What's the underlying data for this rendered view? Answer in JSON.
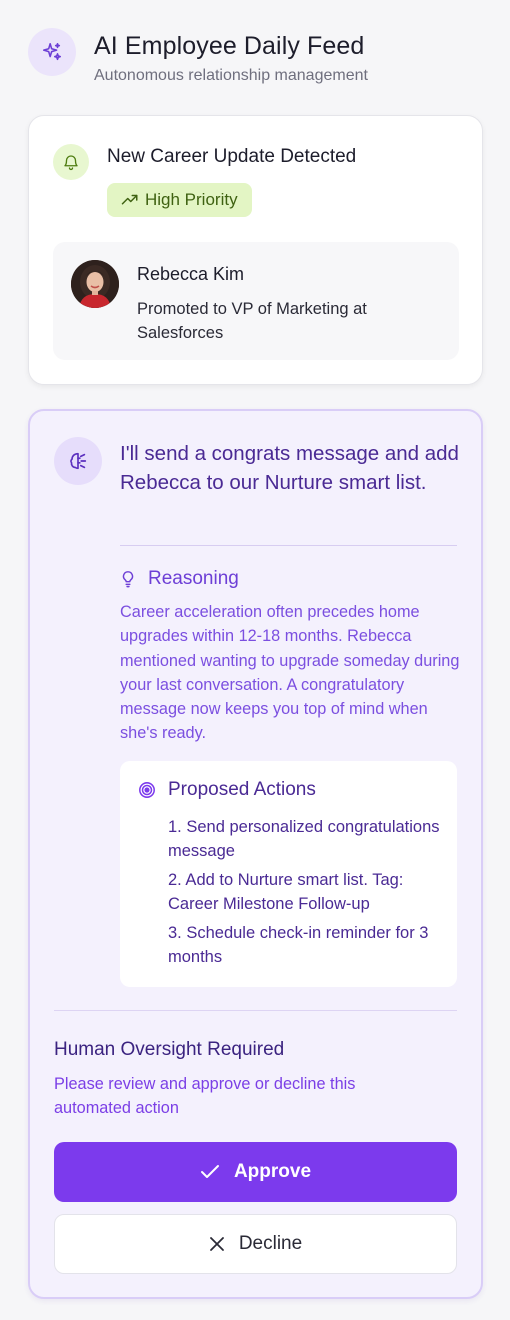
{
  "header": {
    "icon": "sparkles-icon",
    "title": "AI Employee Daily Feed",
    "subtitle": "Autonomous relationship management"
  },
  "alert_card": {
    "icon": "bell-icon",
    "title": "New Career Update Detected",
    "priority_icon": "trending-up-icon",
    "priority_label": "High Priority",
    "contact": {
      "name": "Rebecca Kim",
      "update": "Promoted to VP of Marketing at Salesforces"
    }
  },
  "ai_card": {
    "icon": "brain-icon",
    "message": "I'll send a congrats message and add Rebecca to our Nurture smart list.",
    "reasoning": {
      "icon": "lightbulb-icon",
      "title": "Reasoning",
      "text": "Career acceleration often precedes home upgrades within 12-18 months. Rebecca mentioned wanting to upgrade someday during your last conversation. A congratulatory message now keeps you top of mind when she's ready."
    },
    "proposed_actions": {
      "icon": "target-icon",
      "title": "Proposed Actions",
      "items": [
        "1. Send personalized congratulations message",
        "2. Add to Nurture smart list. Tag: Career Milestone Follow-up",
        "3. Schedule check-in reminder for 3 months"
      ]
    },
    "oversight": {
      "title": "Human Oversight Required",
      "text": "Please review and approve or decline this automated action"
    },
    "approve_label": "Approve",
    "decline_label": "Decline"
  },
  "colors": {
    "accent": "#7c3aed",
    "priority_bg": "#e3f5c4",
    "card_purple_bg": "#f4f1fd"
  }
}
